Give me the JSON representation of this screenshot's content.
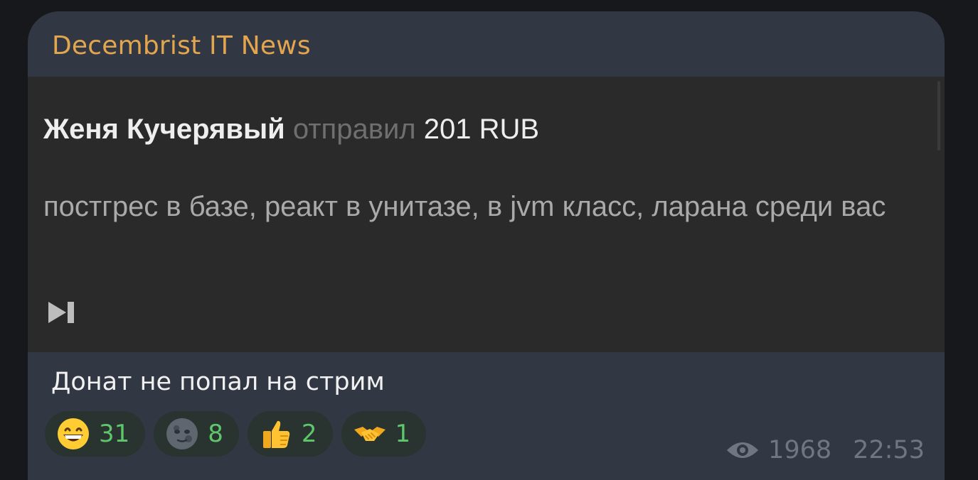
{
  "channel": {
    "name": "Decembrist IT News"
  },
  "donation": {
    "donor": "Женя Кучерявый",
    "verb": "отправил",
    "amount": "201 RUB",
    "message": "постгрес в базе, реакт в унитазе, в jvm класс, ларана среди вас",
    "skip_icon": "skip-next-icon"
  },
  "post": {
    "caption": "Донат не попал на стрим"
  },
  "reactions": [
    {
      "emoji": "grinning-face",
      "count": "31"
    },
    {
      "emoji": "new-moon-face",
      "count": "8"
    },
    {
      "emoji": "thumbs-up",
      "count": "2"
    },
    {
      "emoji": "handshake",
      "count": "1"
    }
  ],
  "meta": {
    "view_icon": "eye-icon",
    "views": "1968",
    "time": "22:53"
  },
  "colors": {
    "channel_name": "#e3a64f",
    "bubble": "#323843",
    "media_bg": "#2a2a2b",
    "reaction_count": "#5fc76b"
  }
}
